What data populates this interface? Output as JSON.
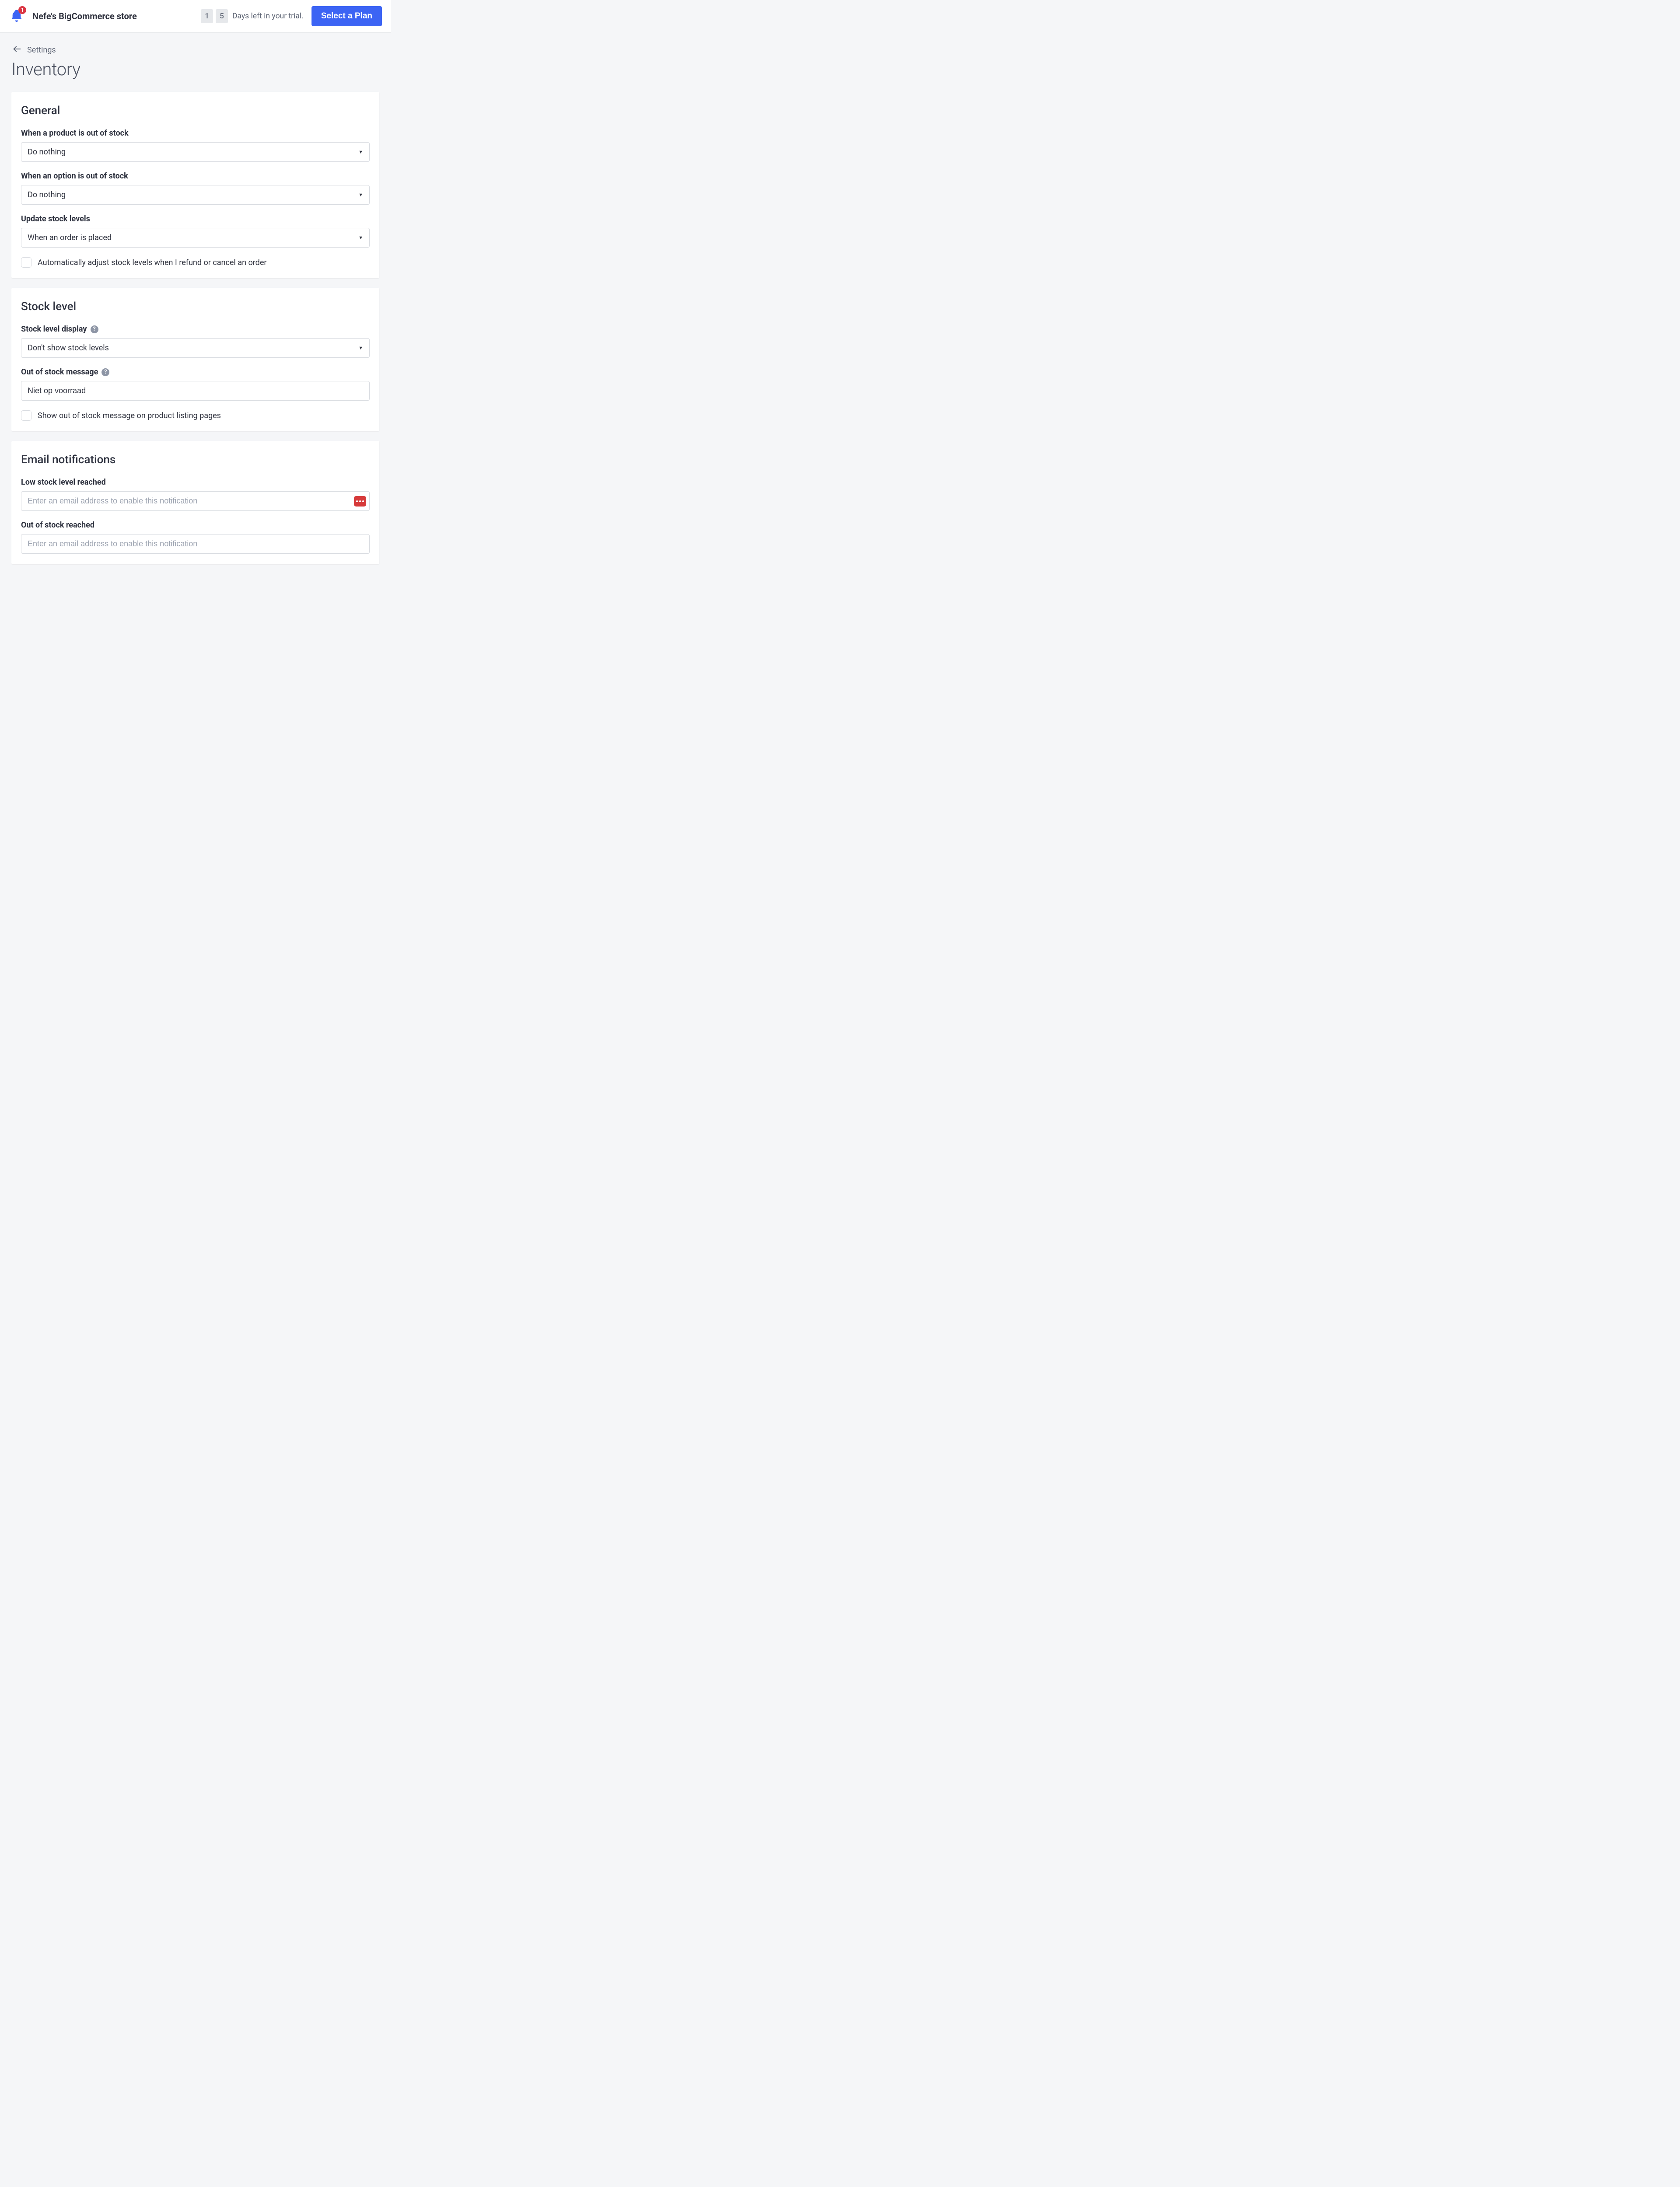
{
  "header": {
    "notification_count": "1",
    "store_name": "Nefe's BigCommerce store",
    "trial_digit_1": "1",
    "trial_digit_2": "5",
    "trial_text": "Days left in your trial.",
    "plan_button": "Select a Plan"
  },
  "breadcrumb": {
    "back_label": "Settings"
  },
  "page": {
    "title": "Inventory"
  },
  "general": {
    "title": "General",
    "product_oos_label": "When a product is out of stock",
    "product_oos_value": "Do nothing",
    "option_oos_label": "When an option is out of stock",
    "option_oos_value": "Do nothing",
    "update_stock_label": "Update stock levels",
    "update_stock_value": "When an order is placed",
    "auto_adjust_label": "Automatically adjust stock levels when I refund or cancel an order"
  },
  "stocklevel": {
    "title": "Stock level",
    "display_label": "Stock level display",
    "display_value": "Don't show stock levels",
    "oos_msg_label": "Out of stock message",
    "oos_msg_value": "Niet op voorraad",
    "show_on_listing_label": "Show out of stock message on product listing pages"
  },
  "email": {
    "title": "Email notifications",
    "low_stock_label": "Low stock level reached",
    "low_stock_placeholder": "Enter an email address to enable this notification",
    "oos_label": "Out of stock reached",
    "oos_placeholder": "Enter an email address to enable this notification"
  }
}
